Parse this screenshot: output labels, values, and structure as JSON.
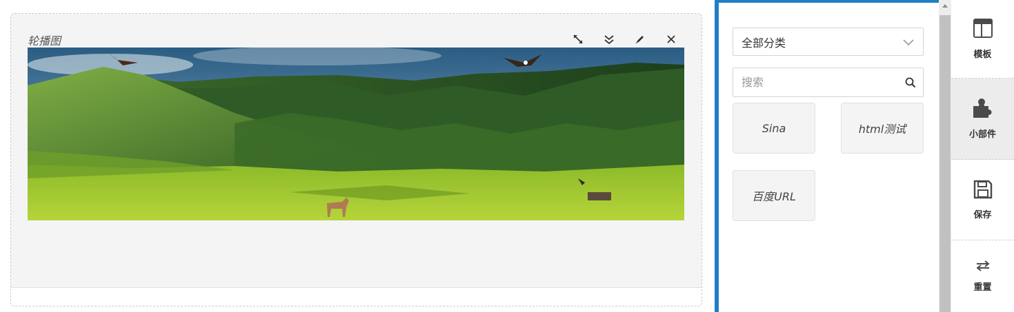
{
  "widget": {
    "title": "轮播图",
    "tools": [
      "expand-icon",
      "collapse-icon",
      "edit-icon",
      "close-icon"
    ]
  },
  "panel": {
    "category_select": {
      "value": "全部分类"
    },
    "search": {
      "placeholder": "搜索"
    },
    "widgets": [
      {
        "label": "Sina"
      },
      {
        "label": "html测试"
      },
      {
        "label": "百度URL"
      }
    ]
  },
  "sidebar": {
    "items": [
      {
        "label": "模板",
        "icon": "template-icon"
      },
      {
        "label": "小部件",
        "icon": "puzzle-icon",
        "active": true
      },
      {
        "label": "保存",
        "icon": "save-icon"
      },
      {
        "label": "重置",
        "icon": "reset-icon"
      }
    ]
  },
  "colors": {
    "accent": "#1e7fc5",
    "panel_bg": "#f4f4f4",
    "active_item": "#ececec"
  }
}
